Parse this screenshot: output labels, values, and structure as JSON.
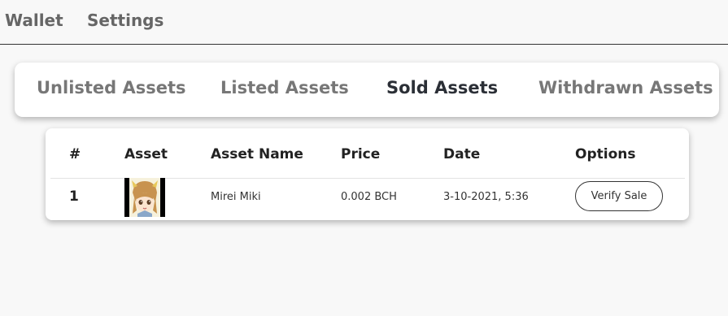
{
  "topnav": {
    "items": [
      {
        "label": "Wallet"
      },
      {
        "label": "Settings"
      }
    ]
  },
  "tabs": {
    "items": [
      {
        "label": "Unlisted Assets",
        "active": false
      },
      {
        "label": "Listed Assets",
        "active": false
      },
      {
        "label": "Sold Assets",
        "active": true
      },
      {
        "label": "Withdrawn Assets",
        "active": false
      }
    ]
  },
  "table": {
    "headers": [
      "#",
      "Asset",
      "Asset Name",
      "Price",
      "Date",
      "Options"
    ],
    "rows": [
      {
        "num": "1",
        "asset_icon": "anime-character-thumbnail",
        "name": "Mirei Miki",
        "price": "0.002 BCH",
        "date": "3-10-2021, 5:36",
        "option_label": "Verify Sale"
      }
    ]
  },
  "colors": {
    "active_tab": "#2b2f36",
    "inactive_tab": "#777777",
    "background": "#f8f8f8"
  }
}
